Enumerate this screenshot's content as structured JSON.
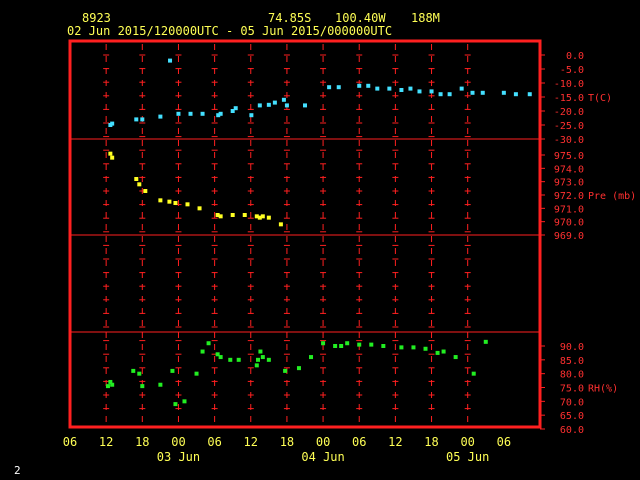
{
  "header": {
    "station": "8923",
    "lat": "74.85S",
    "lon": "100.40W",
    "elev": "188M",
    "period": "02 Jun 2015/120000UTC - 05 Jun 2015/000000UTC"
  },
  "corner_label": "2",
  "colors": {
    "frame": "#ff2020",
    "divider": "#ff2020",
    "axis_text": "#ffff55",
    "panel_text": "#ff3030",
    "temp": "#44e0ff",
    "pres": "#ffff22",
    "rh": "#22ee22"
  },
  "chart_data": [
    {
      "type": "scatter",
      "name": "T(C)",
      "ylabel": "T(C)",
      "ylim": [
        -30,
        0
      ],
      "yticks": [
        "0.0",
        "-5.0",
        "-10.0",
        "-15.0",
        "-20.0",
        "-25.0",
        "-30.0"
      ],
      "ytick_values": [
        0,
        -5,
        -10,
        -15,
        -20,
        -25,
        -30
      ],
      "x": [
        0.7,
        1,
        5,
        6,
        9,
        10.6,
        12,
        14,
        16,
        18.6,
        19,
        21,
        21.5,
        24.1,
        25.5,
        27,
        28,
        29.5,
        30,
        33,
        37,
        38.6,
        42,
        43.5,
        45,
        47,
        49,
        50.5,
        52,
        54,
        55.5,
        57,
        59,
        60.8,
        62.5,
        66,
        68,
        70.3
      ],
      "y": [
        -25,
        -24.5,
        -23,
        -23,
        -22,
        -2,
        -21,
        -21,
        -21,
        -21.5,
        -21,
        -20,
        -19,
        -21.5,
        -18,
        -17.8,
        -17,
        -16,
        -18,
        -18,
        -11.5,
        -11.5,
        -11,
        -11,
        -12,
        -12,
        -12.5,
        -12,
        -13,
        -13,
        -14,
        -14,
        -12,
        -13.5,
        -13.5,
        -13.5,
        -14,
        -14
      ]
    },
    {
      "type": "scatter",
      "name": "Pre (mb)",
      "ylabel": "Pre (mb)",
      "ylim": [
        969,
        976
      ],
      "yticks": [
        "975.0",
        "974.0",
        "973.0",
        "972.0",
        "971.0",
        "970.0",
        "969.0"
      ],
      "ytick_values": [
        975,
        974,
        973,
        972,
        971,
        970,
        969
      ],
      "x": [
        0.7,
        1,
        5,
        5.5,
        6.5,
        9,
        10.5,
        11.5,
        13.5,
        15.5,
        18.5,
        19,
        21,
        23,
        25,
        25.5,
        26,
        27,
        29
      ],
      "y": [
        975.1,
        974.8,
        973.2,
        972.8,
        972.3,
        971.6,
        971.5,
        971.4,
        971.3,
        971.0,
        970.5,
        970.4,
        970.5,
        970.5,
        970.4,
        970.3,
        970.4,
        970.3,
        969.8
      ]
    },
    {
      "type": "scatter",
      "name": "RH(%)",
      "ylabel": "RH(%)",
      "ylim": [
        60,
        95
      ],
      "yticks": [
        "90.0",
        "85.0",
        "80.0",
        "75.0",
        "70.0",
        "65.0",
        "60.0"
      ],
      "ytick_values": [
        90,
        85,
        80,
        75,
        70,
        65,
        60
      ],
      "x": [
        0.3,
        0.7,
        1,
        4.5,
        5.5,
        6,
        9,
        11,
        11.5,
        13,
        15,
        16,
        17,
        18.5,
        19,
        20.6,
        22,
        25,
        25.2,
        25.6,
        26,
        27,
        29.7,
        32,
        34,
        36,
        38,
        39,
        40,
        42,
        44,
        46,
        49,
        51,
        53,
        55,
        56,
        58,
        61,
        63
      ],
      "y": [
        75.5,
        77,
        76,
        81,
        80,
        75.5,
        76,
        81,
        69,
        70,
        80,
        88,
        91,
        87,
        86,
        85,
        85,
        83,
        85,
        88,
        86,
        85,
        81,
        82,
        86,
        91,
        90,
        90,
        91,
        90.5,
        90.5,
        90,
        89.5,
        89.5,
        89,
        87.5,
        88,
        86,
        80,
        91.5
      ]
    }
  ],
  "xaxis": {
    "tick_labels": [
      "06",
      "12",
      "18",
      "00",
      "06",
      "12",
      "18",
      "00",
      "06",
      "12",
      "18",
      "00",
      "06"
    ],
    "day_labels": [
      "03 Jun",
      "04 Jun",
      "05 Jun"
    ]
  }
}
